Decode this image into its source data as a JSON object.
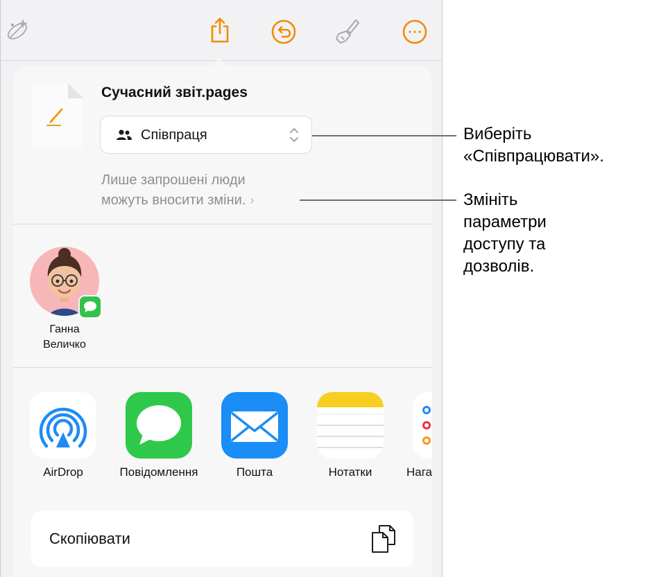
{
  "toolbar": {
    "icons": [
      "magic-wand-icon",
      "share-icon",
      "undo-icon",
      "brush-icon",
      "more-icon"
    ],
    "accent_color": "#f08c00"
  },
  "share_sheet": {
    "file_name": "Сучасний звіт.pages",
    "collaboration_select": "Співпраця",
    "access_note_line1": "Лише запрошені люди",
    "access_note_line2": "можуть вносити зміни."
  },
  "contact": {
    "name_line1": "Ганна",
    "name_line2": "Величко"
  },
  "apps": [
    {
      "label": "AirDrop"
    },
    {
      "label": "Повідомлення"
    },
    {
      "label": "Пошта"
    },
    {
      "label": "Нотатки"
    },
    {
      "label": "Нага"
    }
  ],
  "actions": {
    "copy_label": "Скопіювати"
  },
  "callouts": {
    "select_collab_line1": "Виберіть",
    "select_collab_line2": "«Співпрацювати».",
    "change_access_line1": "Змініть",
    "change_access_line2": "параметри",
    "change_access_line3": "доступу та",
    "change_access_line4": "дозволів."
  }
}
